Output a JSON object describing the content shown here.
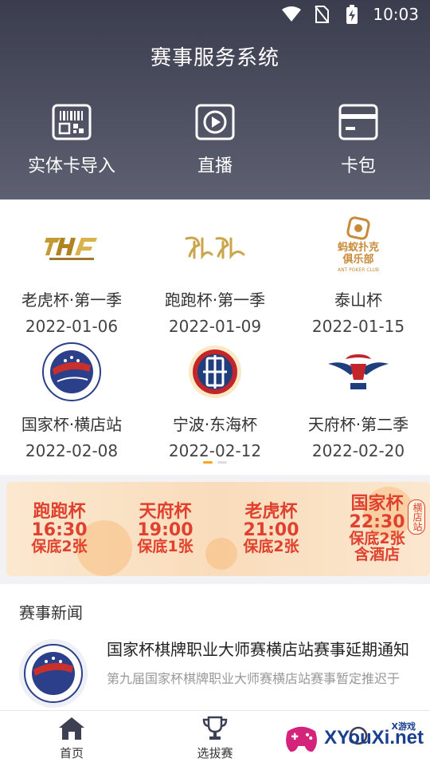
{
  "status_bar": {
    "time": "10:03"
  },
  "header": {
    "title": "赛事服务系统"
  },
  "quick_actions": [
    {
      "label": "实体卡导入",
      "icon": "barcode-scan-icon"
    },
    {
      "label": "直播",
      "icon": "play-icon"
    },
    {
      "label": "卡包",
      "icon": "card-icon"
    }
  ],
  "events": [
    {
      "name": "老虎杯·第一季",
      "date": "2022-01-06",
      "logo": "tiger-cup-logo"
    },
    {
      "name": "跑跑杯·第一季",
      "date": "2022-01-09",
      "logo": "paopao-cup-logo"
    },
    {
      "name": "泰山杯",
      "date": "2022-01-15",
      "logo": "ant-poker-club-logo",
      "logo_text": "蚂蚁扑克",
      "logo_text2": "俱乐部",
      "logo_text3": "ANT POKER CLUB"
    },
    {
      "name": "国家杯·横店站",
      "date": "2022-02-08",
      "logo": "national-cup-logo"
    },
    {
      "name": "宁波·东海杯",
      "date": "2022-02-12",
      "logo": "donghai-cup-logo"
    },
    {
      "name": "天府杯·第二季",
      "date": "2022-02-20",
      "logo": "tianfu-cup-logo"
    }
  ],
  "banner": {
    "items": [
      {
        "cup": "跑跑杯",
        "time": "16:30",
        "note": "保底2张"
      },
      {
        "cup": "天府杯",
        "time": "19:00",
        "note": "保底1张"
      },
      {
        "cup": "老虎杯",
        "time": "21:00",
        "note": "保底2张"
      },
      {
        "cup": "国家杯",
        "time": "22:30",
        "note": "保底2张",
        "note2": "含酒店"
      }
    ],
    "side_tag": "横店站"
  },
  "news": {
    "heading": "赛事新闻",
    "items": [
      {
        "title": "国家杯棋牌职业大师赛横店站赛事延期通知",
        "summary": "第九届国家杯棋牌职业大师赛横店站赛事暂定推迟于"
      }
    ]
  },
  "bottom_nav": [
    {
      "label": "首页",
      "icon": "home-icon"
    },
    {
      "label": "选拔赛",
      "icon": "trophy-icon"
    }
  ],
  "watermark": {
    "text": "XYouXi.net",
    "small": "X游戏"
  },
  "colors": {
    "header_top": "#3a3d4d",
    "header_bottom": "#5d6071",
    "banner_red": "#e0412e",
    "accent": "#f5a623"
  }
}
